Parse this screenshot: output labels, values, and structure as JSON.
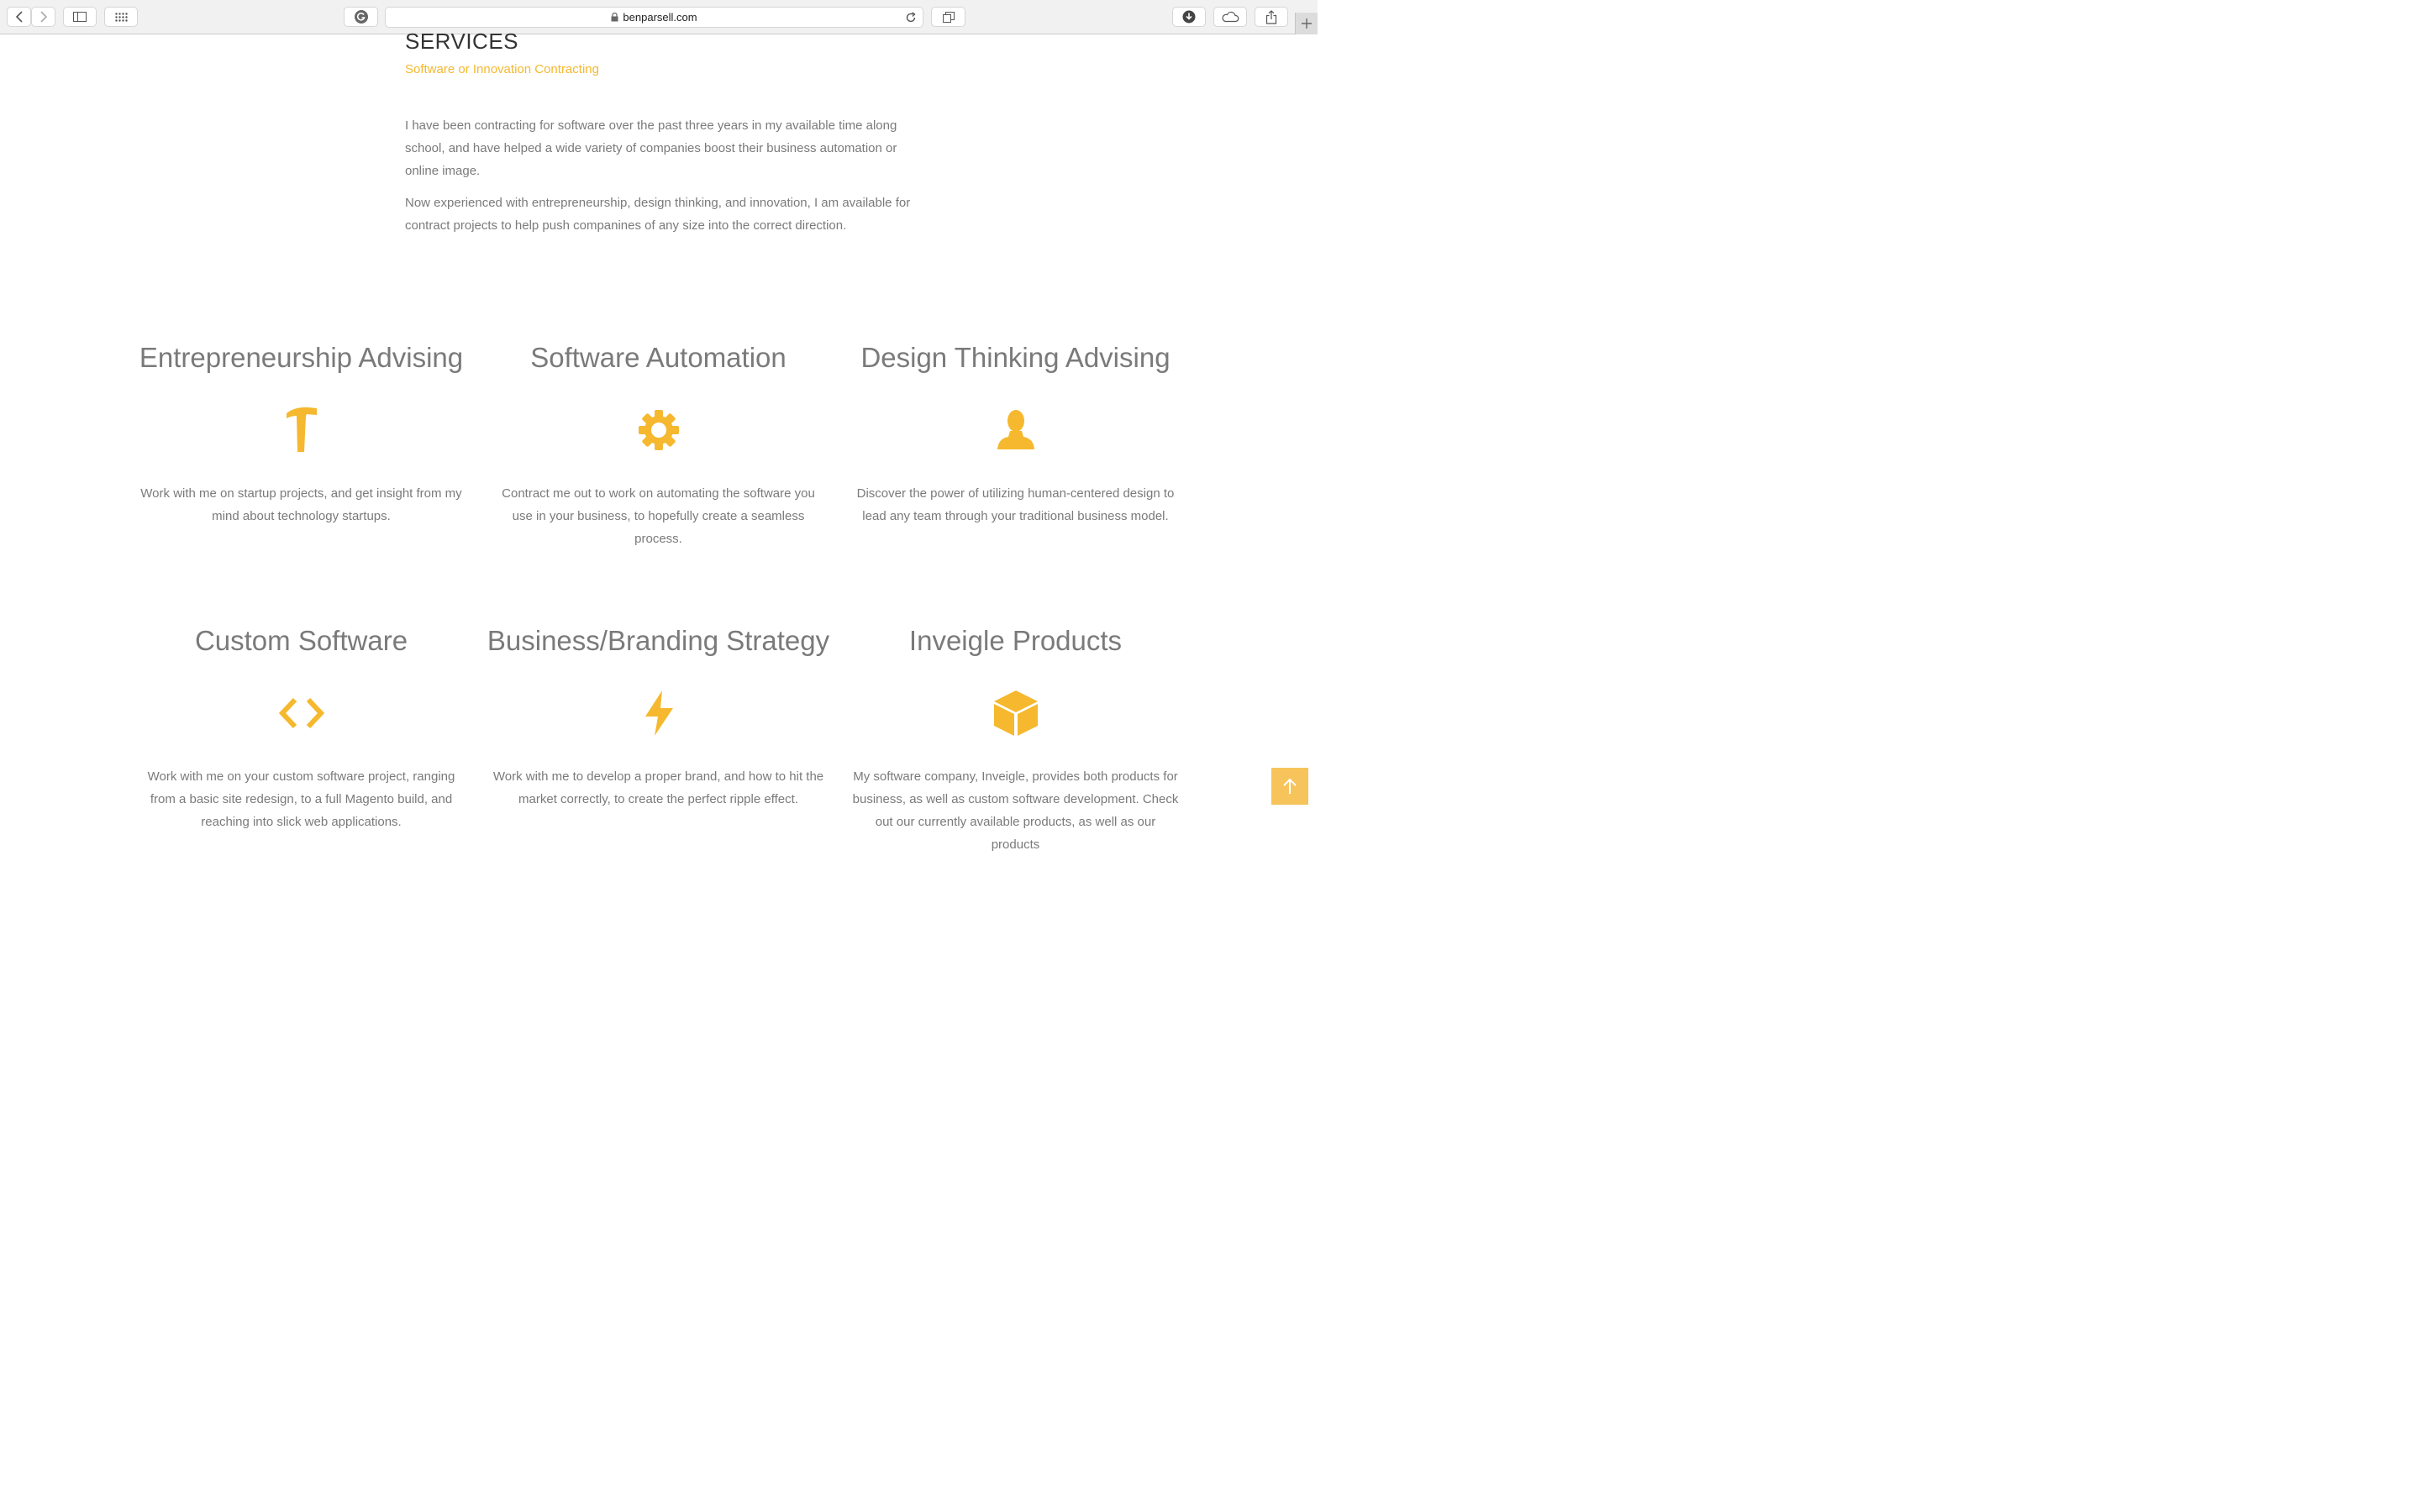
{
  "browser": {
    "url": "benparsell.com",
    "icons": [
      "chevron-left-icon",
      "chevron-right-icon",
      "sidebar-icon",
      "grid-icon",
      "grammarly-icon",
      "lock-icon",
      "reload-icon",
      "tabs-icon",
      "download-icon",
      "cloud-icon",
      "share-icon",
      "plus-icon"
    ]
  },
  "section": {
    "title": "SERVICES",
    "subtitle": "Software or Innovation Contracting",
    "paragraph1": "I have been contracting for software over the past three years in my available time along school, and have helped a wide variety of companies boost their business automation or online image.",
    "paragraph2": "Now experienced with entrepreneurship, design thinking, and innovation, I am available for contract projects to help push companines of any size into the correct direction."
  },
  "services": [
    {
      "title": "Entrepreneurship Advising",
      "icon": "hammer-icon",
      "description": "Work with me on startup projects, and get insight from my mind about technology startups."
    },
    {
      "title": "Software Automation",
      "icon": "gear-icon",
      "description": "Contract me out to work on automating the software you use in your business, to hopefully create a seamless process."
    },
    {
      "title": "Design Thinking Advising",
      "icon": "user-icon",
      "description": "Discover the power of utilizing human-centered design to lead any team through your traditional business model."
    },
    {
      "title": "Custom Software",
      "icon": "code-icon",
      "description": "Work with me on your custom software project, ranging from a basic site redesign, to a full Magento build, and reaching into slick web applications."
    },
    {
      "title": "Business/Branding Strategy",
      "icon": "lightning-icon",
      "description": "Work with me to develop a proper brand, and how to hit the market correctly, to create the perfect ripple effect."
    },
    {
      "title": "Inveigle Products",
      "icon": "cube-icon",
      "description": "My software company, Inveigle, provides both products for business, as well as custom software development. Check out our currently available products, as well as our products"
    }
  ],
  "colors": {
    "accent": "#f5b82e",
    "text": "#7a7a7a",
    "heading": "#333333",
    "back_to_top": "#f6c45a"
  },
  "back_to_top_icon": "arrow-up-icon"
}
